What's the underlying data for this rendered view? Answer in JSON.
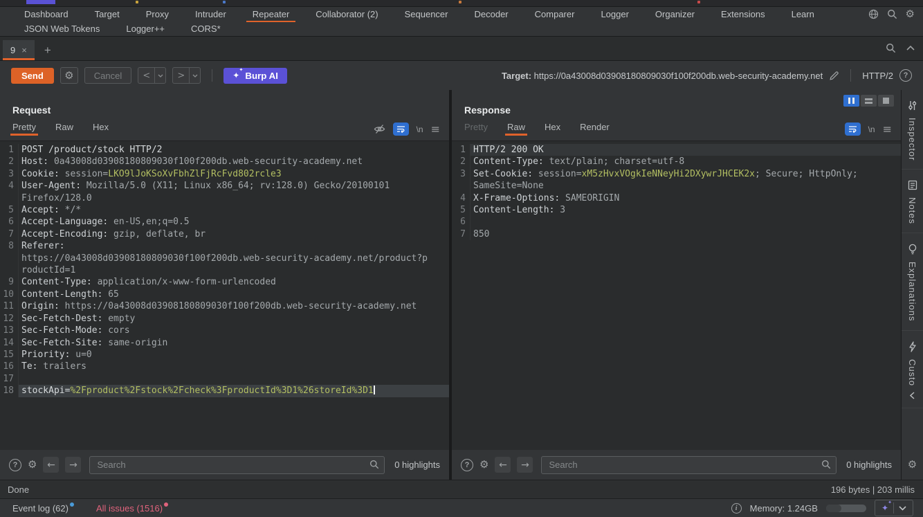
{
  "menubar": {
    "row1": [
      "Dashboard",
      "Target",
      "Proxy",
      "Intruder",
      "Repeater",
      "Collaborator (2)",
      "Sequencer",
      "Decoder",
      "Comparer",
      "Logger",
      "Organizer",
      "Extensions",
      "Learn"
    ],
    "selected": "Repeater",
    "row2": [
      "JSON Web Tokens",
      "Logger++",
      "CORS*"
    ],
    "icons": [
      "globe-icon",
      "search-icon",
      "gear-icon"
    ]
  },
  "tabbar": {
    "tab_label": "9"
  },
  "toolbar": {
    "send_label": "Send",
    "cancel_label": "Cancel",
    "ai_label": "Burp AI",
    "target_label": "Target:",
    "target_url": "https://0a43008d03908180809030f100f200db.web-security-academy.net",
    "protocol": "HTTP/2"
  },
  "request": {
    "title": "Request",
    "tabs": [
      "Pretty",
      "Raw",
      "Hex"
    ],
    "active_tab": "Pretty",
    "disabled_tabs": [],
    "newline_label": "\\n",
    "search_placeholder": "Search",
    "highlights_label": "0 highlights",
    "lines": [
      {
        "n": "1",
        "s": [
          [
            "b",
            "POST /product/stock HTTP/2"
          ]
        ]
      },
      {
        "n": "2",
        "s": [
          [
            "n",
            "Host:"
          ],
          [
            "v",
            " 0a43008d03908180809030f100f200db.web-security-academy.net"
          ]
        ]
      },
      {
        "n": "3",
        "s": [
          [
            "n",
            "Cookie:"
          ],
          [
            "v",
            " session="
          ],
          [
            "g",
            "LKO9lJoKSoXvFbhZlFjRcFvd802rcle3"
          ]
        ]
      },
      {
        "n": "4",
        "s": [
          [
            "n",
            "User-Agent:"
          ],
          [
            "v",
            " Mozilla/5.0 (X11; Linux x86_64; rv:128.0) Gecko/20100101"
          ]
        ]
      },
      {
        "n": "",
        "s": [
          [
            "v",
            "Firefox/128.0"
          ]
        ]
      },
      {
        "n": "5",
        "s": [
          [
            "n",
            "Accept:"
          ],
          [
            "v",
            " */*"
          ]
        ]
      },
      {
        "n": "6",
        "s": [
          [
            "n",
            "Accept-Language:"
          ],
          [
            "v",
            " en-US,en;q=0.5"
          ]
        ]
      },
      {
        "n": "7",
        "s": [
          [
            "n",
            "Accept-Encoding:"
          ],
          [
            "v",
            " gzip, deflate, br"
          ]
        ]
      },
      {
        "n": "8",
        "s": [
          [
            "n",
            "Referer:"
          ]
        ]
      },
      {
        "n": "",
        "s": [
          [
            "v",
            "https://0a43008d03908180809030f100f200db.web-security-academy.net/product?p"
          ]
        ]
      },
      {
        "n": "",
        "s": [
          [
            "v",
            "roductId=1"
          ]
        ]
      },
      {
        "n": "9",
        "s": [
          [
            "n",
            "Content-Type:"
          ],
          [
            "v",
            " application/x-www-form-urlencoded"
          ]
        ]
      },
      {
        "n": "10",
        "s": [
          [
            "n",
            "Content-Length:"
          ],
          [
            "v",
            " 65"
          ]
        ]
      },
      {
        "n": "11",
        "s": [
          [
            "n",
            "Origin:"
          ],
          [
            "v",
            " https://0a43008d03908180809030f100f200db.web-security-academy.net"
          ]
        ]
      },
      {
        "n": "12",
        "s": [
          [
            "n",
            "Sec-Fetch-Dest:"
          ],
          [
            "v",
            " empty"
          ]
        ]
      },
      {
        "n": "13",
        "s": [
          [
            "n",
            "Sec-Fetch-Mode:"
          ],
          [
            "v",
            " cors"
          ]
        ]
      },
      {
        "n": "14",
        "s": [
          [
            "n",
            "Sec-Fetch-Site:"
          ],
          [
            "v",
            " same-origin"
          ]
        ]
      },
      {
        "n": "15",
        "s": [
          [
            "n",
            "Priority:"
          ],
          [
            "v",
            " u=0"
          ]
        ]
      },
      {
        "n": "16",
        "s": [
          [
            "n",
            "Te:"
          ],
          [
            "v",
            " trailers"
          ]
        ]
      },
      {
        "n": "17",
        "s": []
      },
      {
        "n": "18",
        "hl": true,
        "cursor": true,
        "s": [
          [
            "b",
            "stockApi="
          ],
          [
            "g",
            "%2Fproduct%2Fstock%2Fcheck%3FproductId%3D1%26storeId%3D1"
          ]
        ]
      }
    ]
  },
  "response": {
    "title": "Response",
    "tabs": [
      "Pretty",
      "Raw",
      "Hex",
      "Render"
    ],
    "active_tab": "Raw",
    "disabled_tabs": [
      "Pretty"
    ],
    "newline_label": "\\n",
    "search_placeholder": "Search",
    "highlights_label": "0 highlights",
    "lines": [
      {
        "n": "1",
        "hl": true,
        "s": [
          [
            "b",
            "HTTP/2 200 OK"
          ]
        ]
      },
      {
        "n": "2",
        "s": [
          [
            "n",
            "Content-Type:"
          ],
          [
            "v",
            " text/plain; charset=utf-8"
          ]
        ]
      },
      {
        "n": "3",
        "s": [
          [
            "n",
            "Set-Cookie:"
          ],
          [
            "v",
            " session="
          ],
          [
            "g",
            "xM5zHvxVOgkIeNNeyHi2DXywrJHCEK2x"
          ],
          [
            "v",
            "; Secure; HttpOnly;"
          ]
        ]
      },
      {
        "n": "",
        "s": [
          [
            "v",
            "SameSite=None"
          ]
        ]
      },
      {
        "n": "4",
        "s": [
          [
            "n",
            "X-Frame-Options:"
          ],
          [
            "v",
            " SAMEORIGIN"
          ]
        ]
      },
      {
        "n": "5",
        "s": [
          [
            "n",
            "Content-Length:"
          ],
          [
            "v",
            " 3"
          ]
        ]
      },
      {
        "n": "6",
        "s": []
      },
      {
        "n": "7",
        "s": [
          [
            "v",
            "850"
          ]
        ]
      }
    ]
  },
  "sidebar": {
    "items": [
      {
        "icon": "inspector-icon",
        "label": "Inspector",
        "chevron": false
      },
      {
        "icon": "notes-icon",
        "label": "Notes",
        "chevron": false
      },
      {
        "icon": "lightbulb-icon",
        "label": "Explanations",
        "chevron": false
      },
      {
        "icon": "bolt-icon",
        "label": "Custo",
        "chevron": true
      }
    ]
  },
  "statusbar": {
    "status": "Done",
    "metrics": "196 bytes | 203 millis"
  },
  "footer": {
    "event_log": "Event log (62)",
    "all_issues": "All issues (1516)",
    "memory": "Memory: 1.24GB"
  },
  "colors": {
    "accent_orange": "#e0622b",
    "burp_purple": "#5b51d6",
    "value_green": "#b3bf62",
    "wrap_blue": "#2f6fd0",
    "issue_pink": "#e0637c",
    "event_dot_blue": "#4a9bd8"
  }
}
